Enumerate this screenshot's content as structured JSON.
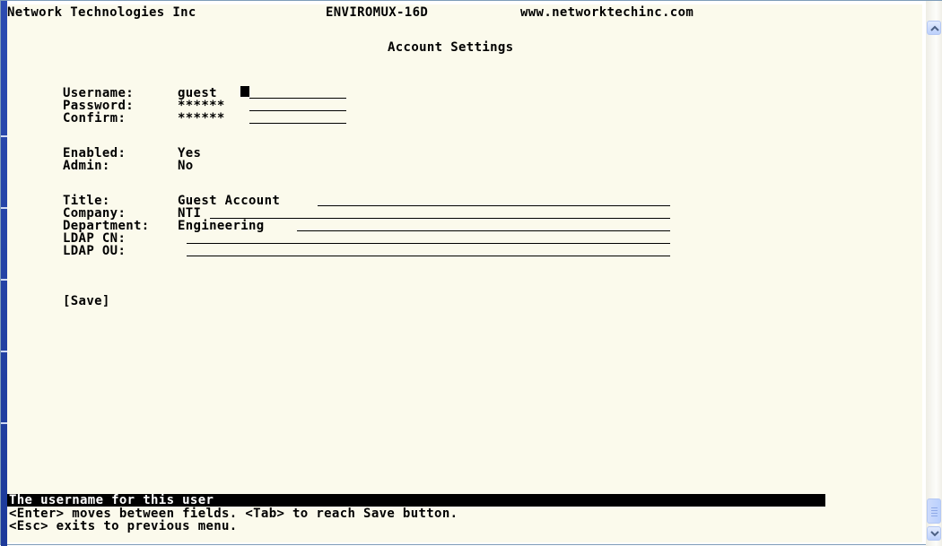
{
  "header": {
    "company": "Network Technologies Inc",
    "product": "ENVIROMUX-16D",
    "website": "www.networktechinc.com",
    "title": "Account Settings"
  },
  "fields": [
    {
      "label": "Username:",
      "value": "guest"
    },
    {
      "label": "Password:",
      "value": "******"
    },
    {
      "label": "Confirm:",
      "value": "******"
    },
    {
      "label": "Enabled:",
      "value": "Yes"
    },
    {
      "label": "Admin:",
      "value": "No"
    },
    {
      "label": "Title:",
      "value": "Guest Account"
    },
    {
      "label": "Company:",
      "value": "NTI"
    },
    {
      "label": "Department:",
      "value": "Engineering"
    },
    {
      "label": "LDAP CN:",
      "value": ""
    },
    {
      "label": "LDAP OU:",
      "value": ""
    }
  ],
  "save_label": "[Save]",
  "status": {
    "help_text": "The username for this user",
    "hint_line1": "<Enter> moves between fields. <Tab> to reach Save button.",
    "hint_line2": "<Esc> exits to previous menu."
  },
  "scrollbar": {
    "up_icon": "chevron-up-icon",
    "down_icon": "chevron-down-icon"
  }
}
